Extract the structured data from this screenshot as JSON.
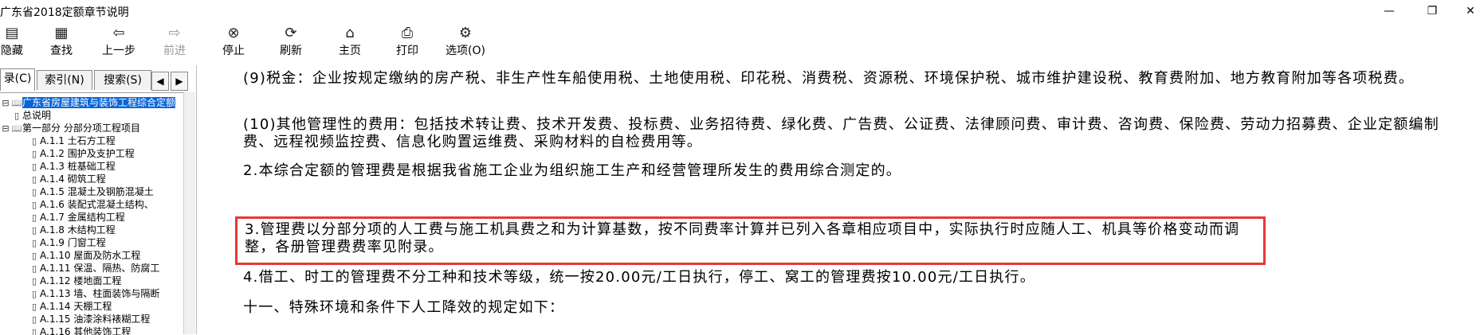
{
  "window": {
    "title": "广东省2018定额章节说明",
    "controls": {
      "minimize": "—",
      "restore": "❐",
      "close": "✕"
    }
  },
  "toolbar": {
    "items": [
      {
        "label": "隐藏",
        "icon": "hide-icon"
      },
      {
        "label": "查找",
        "icon": "find-icon"
      },
      {
        "label": "上一步",
        "icon": "back-arrow-icon"
      },
      {
        "label": "前进",
        "icon": "forward-arrow-icon",
        "disabled": true
      },
      {
        "label": "停止",
        "icon": "stop-icon"
      },
      {
        "label": "刷新",
        "icon": "refresh-icon"
      },
      {
        "label": "主页",
        "icon": "home-icon"
      },
      {
        "label": "打印",
        "icon": "print-icon"
      },
      {
        "label": "选项(O)",
        "icon": "options-icon"
      }
    ]
  },
  "sidebar": {
    "tabs": [
      "录(C)",
      "索引(N)",
      "搜索(S)"
    ],
    "active_tab": 0,
    "tree": [
      {
        "label": "广东省房屋建筑与装饰工程综合定额",
        "level": 0,
        "selected": true
      },
      {
        "label": "总说明",
        "level": 1
      },
      {
        "label": "第一部分 分部分项工程项目",
        "level": 1
      },
      {
        "label": "A.1.1 土石方工程",
        "level": 2
      },
      {
        "label": "A.1.2 围护及支护工程",
        "level": 2
      },
      {
        "label": "A.1.3 桩基础工程",
        "level": 2
      },
      {
        "label": "A.1.4 砌筑工程",
        "level": 2
      },
      {
        "label": "A.1.5 混凝土及钢筋混凝土",
        "level": 2
      },
      {
        "label": "A.1.6 装配式混凝土结构、",
        "level": 2
      },
      {
        "label": "A.1.7 金属结构工程",
        "level": 2
      },
      {
        "label": "A.1.8 木结构工程",
        "level": 2
      },
      {
        "label": "A.1.9 门窗工程",
        "level": 2
      },
      {
        "label": "A.1.10 屋面及防水工程",
        "level": 2
      },
      {
        "label": "A.1.11 保温、隔热、防腐工",
        "level": 2
      },
      {
        "label": "A.1.12 楼地面工程",
        "level": 2
      },
      {
        "label": "A.1.13 墙、柱面装饰与隔断",
        "level": 2
      },
      {
        "label": "A.1.14 天棚工程",
        "level": 2
      },
      {
        "label": "A.1.15 油漆涂料裱糊工程",
        "level": 2
      },
      {
        "label": "A.1.16 其他装饰工程",
        "level": 2
      }
    ]
  },
  "content": {
    "paragraphs": [
      "(9)税金：企业按规定缴纳的房产税、非生产性车船使用税、土地使用税、印花税、消费税、资源税、环境保护税、城市维护建设税、教育费附加、地方教育附加等各项税费。",
      "(10)其他管理性的费用：包括技术转让费、技术开发费、投标费、业务招待费、绿化费、广告费、公证费、法律顾问费、审计费、咨询费、保险费、劳动力招募费、企业定额编制费、远程视频监控费、信息化购置运维费、采购材料的自检费用等。",
      "2.本综合定额的管理费是根据我省施工企业为组织施工生产和经营管理所发生的费用综合测定的。",
      "3.管理费以分部分项的人工费与施工机具费之和为计算基数，按不同费率计算并已列入各章相应项目中，实际执行时应随人工、机具等价格变动而调整，各册管理费费率见附录。",
      "4.借工、时工的管理费不分工种和技术等级，统一按20.00元/工日执行，停工、窝工的管理费按10.00元/工日执行。",
      "十一、特殊环境和条件下人工降效的规定如下："
    ],
    "highlight_color": "#e53935",
    "selected_color": "#0a64d8"
  }
}
